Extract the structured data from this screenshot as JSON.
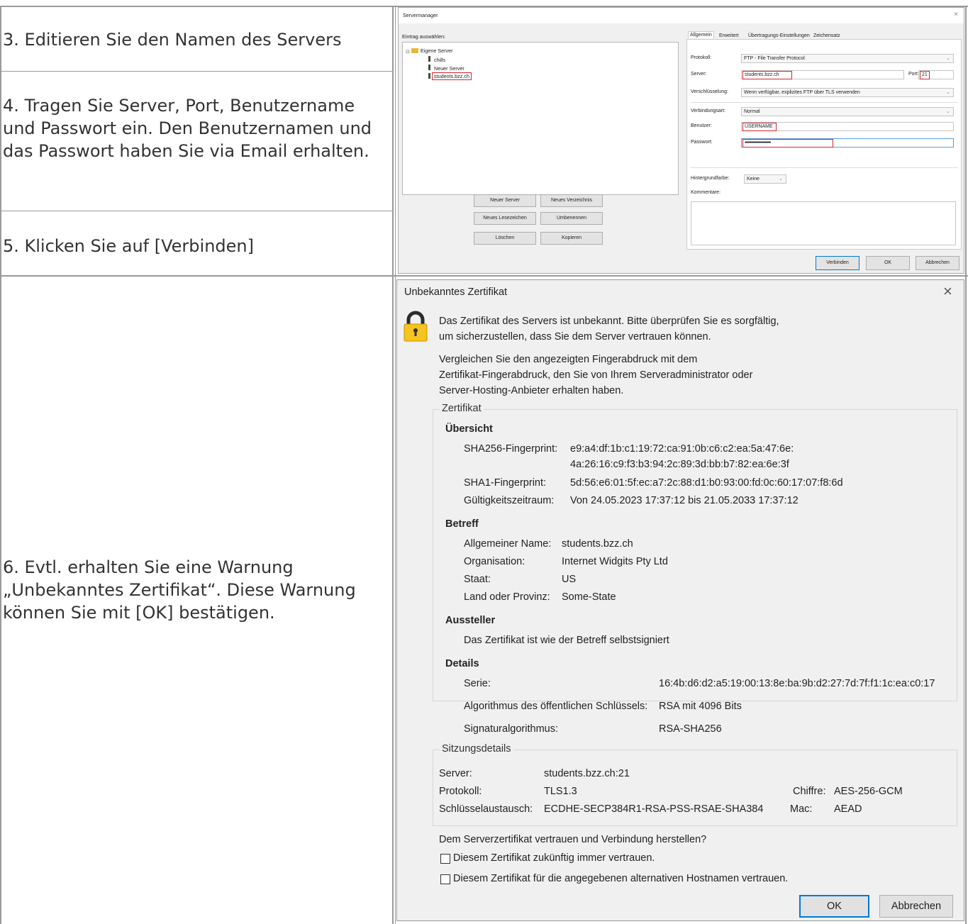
{
  "steps": [
    "3. Editieren Sie den Namen des Servers",
    "4. Tragen Sie Server, Port, Benutzername und Passwort ein. Den Benutzernamen und das Passwort haben Sie via Email erhalten.",
    "5. Klicken Sie auf [Verbinden]",
    "6. Evtl. erhalten Sie eine Warnung „Unbekanntes Zertifikat“. Diese Warnung können Sie mit [OK] bestätigen."
  ],
  "server_manager": {
    "title": "Servermanager",
    "close": "×",
    "entry_label": "Eintrag auswählen:",
    "tree": {
      "root": "Eigene Server",
      "items": [
        "chills",
        "Neuer Server",
        "students.bzz.ch"
      ]
    },
    "buttons": {
      "new_server": "Neuer Server",
      "new_folder": "Neues Verzeichnis",
      "new_bookmark": "Neues Lesezeichen",
      "rename": "Umbenennen",
      "delete": "Löschen",
      "copy": "Kopieren"
    },
    "tabs": [
      "Allgemein",
      "Erweitert",
      "Übertragungs-Einstellungen",
      "Zeichensatz"
    ],
    "form": {
      "protocol_label": "Protokoll:",
      "protocol_value": "FTP - File Transfer Protocol",
      "server_label": "Server:",
      "server_value": "students.bzz.ch",
      "port_label": "Port:",
      "port_value": "21",
      "encryption_label": "Verschlüsselung:",
      "encryption_value": "Wenn verfügbar, explizites FTP über TLS verwenden",
      "logon_label": "Verbindungsart:",
      "logon_value": "Normal",
      "user_label": "Benutzer:",
      "user_value": "USERNAME",
      "password_label": "Passwort:",
      "password_value": "•••••••••••••••••••••••••",
      "bgcolor_label": "Hintergrundfarbe:",
      "bgcolor_value": "Keine",
      "comments_label": "Kommentare:"
    },
    "footer": {
      "connect": "Verbinden",
      "ok": "OK",
      "cancel": "Abbrechen"
    }
  },
  "cert_dialog": {
    "title": "Unbekanntes Zertifikat",
    "close": "×",
    "intro_line1": "Das Zertifikat des Servers ist unbekannt. Bitte überprüfen Sie es sorgfältig,",
    "intro_line2": "um sicherzustellen, dass Sie dem Server vertrauen können.",
    "compare_line1": "Vergleichen Sie den angezeigten Fingerabdruck mit dem",
    "compare_line2": "Zertifikat-Fingerabdruck, den Sie von Ihrem Serveradministrator oder",
    "compare_line3": "Server-Hosting-Anbieter erhalten haben.",
    "cert_group": "Zertifikat",
    "overview": {
      "heading": "Übersicht",
      "sha256_label": "SHA256-Fingerprint:",
      "sha256_line1": "e9:a4:df:1b:c1:19:72:ca:91:0b:c6:c2:ea:5a:47:6e:",
      "sha256_line2": "4a:26:16:c9:f3:b3:94:2c:89:3d:bb:b7:82:ea:6e:3f",
      "sha1_label": "SHA1-Fingerprint:",
      "sha1_value": "5d:56:e6:01:5f:ec:a7:2c:88:d1:b0:93:00:fd:0c:60:17:07:f8:6d",
      "validity_label": "Gültigkeitszeitraum:",
      "validity_value": "Von 24.05.2023 17:37:12 bis 21.05.2033 17:37:12"
    },
    "subject": {
      "heading": "Betreff",
      "cn_label": "Allgemeiner Name:",
      "cn_value": "students.bzz.ch",
      "org_label": "Organisation:",
      "org_value": "Internet Widgits Pty Ltd",
      "country_label": "Staat:",
      "country_value": "US",
      "state_label": "Land oder Provinz:",
      "state_value": "Some-State"
    },
    "issuer": {
      "heading": "Aussteller",
      "text": "Das Zertifikat ist wie der Betreff selbstsigniert"
    },
    "details": {
      "heading": "Details",
      "serial_label": "Serie:",
      "serial_value": "16:4b:d6:d2:a5:19:00:13:8e:ba:9b:d2:27:7d:7f:f1:1c:ea:c0:17",
      "pubkey_label": "Algorithmus des öffentlichen Schlüssels:",
      "pubkey_value": "RSA mit 4096 Bits",
      "sig_label": "Signaturalgorithmus:",
      "sig_value": "RSA-SHA256"
    },
    "session": {
      "group": "Sitzungsdetails",
      "server_label": "Server:",
      "server_value": "students.bzz.ch:21",
      "protocol_label": "Protokoll:",
      "protocol_value": "TLS1.3",
      "cipher_label": "Chiffre:",
      "cipher_value": "AES-256-GCM",
      "kex_label": "Schlüsselaustausch:",
      "kex_value": "ECDHE-SECP384R1-RSA-PSS-RSAE-SHA384",
      "mac_label": "Mac:",
      "mac_value": "AEAD"
    },
    "question": "Dem Serverzertifikat vertrauen und Verbindung herstellen?",
    "checkbox1": "Diesem Zertifikat zukünftig immer vertrauen.",
    "checkbox2": "Diesem Zertifikat für die angegebenen alternativen Hostnamen vertrauen.",
    "ok": "OK",
    "cancel": "Abbrechen"
  }
}
